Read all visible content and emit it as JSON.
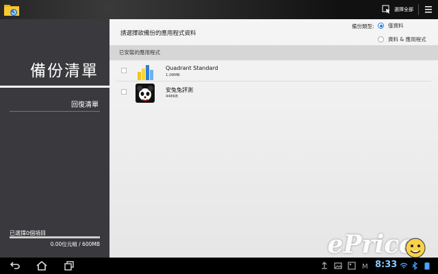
{
  "topbar": {
    "select_all_label": "選擇全部"
  },
  "sidebar": {
    "title": "備份清單",
    "restore_label": "回復清單",
    "selected_count": "已選擇0個項目",
    "progress_fraction": 0,
    "size_text": "0.00位元組 / 600MB"
  },
  "main": {
    "prompt": "請選擇欲備份的應用程式資料",
    "backup_type_label": "備份類型:",
    "backup_options": [
      "僅資料",
      "資料 & 應用程式"
    ],
    "selected_option": 0,
    "section_header": "已安裝的應用程式",
    "apps": [
      {
        "name": "Quadrant Standard",
        "size": "1.08MB",
        "icon": "quadrant-bar-chart-icon"
      },
      {
        "name": "安兔兔評測",
        "size": "448KB",
        "icon": "antutu-panda-icon"
      }
    ]
  },
  "watermark": "ePrice",
  "statusbar": {
    "clock": "8:33"
  },
  "colors": {
    "accent": "#2a7bd3",
    "sidebar_bg": "#3a3a3e",
    "clock": "#8fc8ff"
  }
}
